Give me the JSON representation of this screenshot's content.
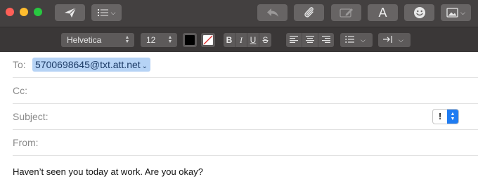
{
  "toolbar": {
    "icons": [
      "send-icon",
      "list-icon",
      "reply-icon",
      "paperclip-icon",
      "markup-icon",
      "fonts-icon",
      "emoji-icon",
      "photo-icon"
    ],
    "fonts_label": "A"
  },
  "format_bar": {
    "font_family": "Helvetica",
    "font_size": "12",
    "text_color": "#000000",
    "background_color": "none",
    "bold": "B",
    "italic": "I",
    "underline": "U",
    "strikethrough": "S"
  },
  "header": {
    "to_label": "To:",
    "to_recipient": "5700698645@txt.att.net",
    "cc_label": "Cc:",
    "subject_label": "Subject:",
    "from_label": "From:",
    "priority_label": "!"
  },
  "message": {
    "body": "Haven’t seen you today at work. Are you okay?"
  },
  "colors": {
    "recipient_chip": "#b6d3f5",
    "accent": "#1f7cf2",
    "toolbar_bg": "#434040"
  }
}
